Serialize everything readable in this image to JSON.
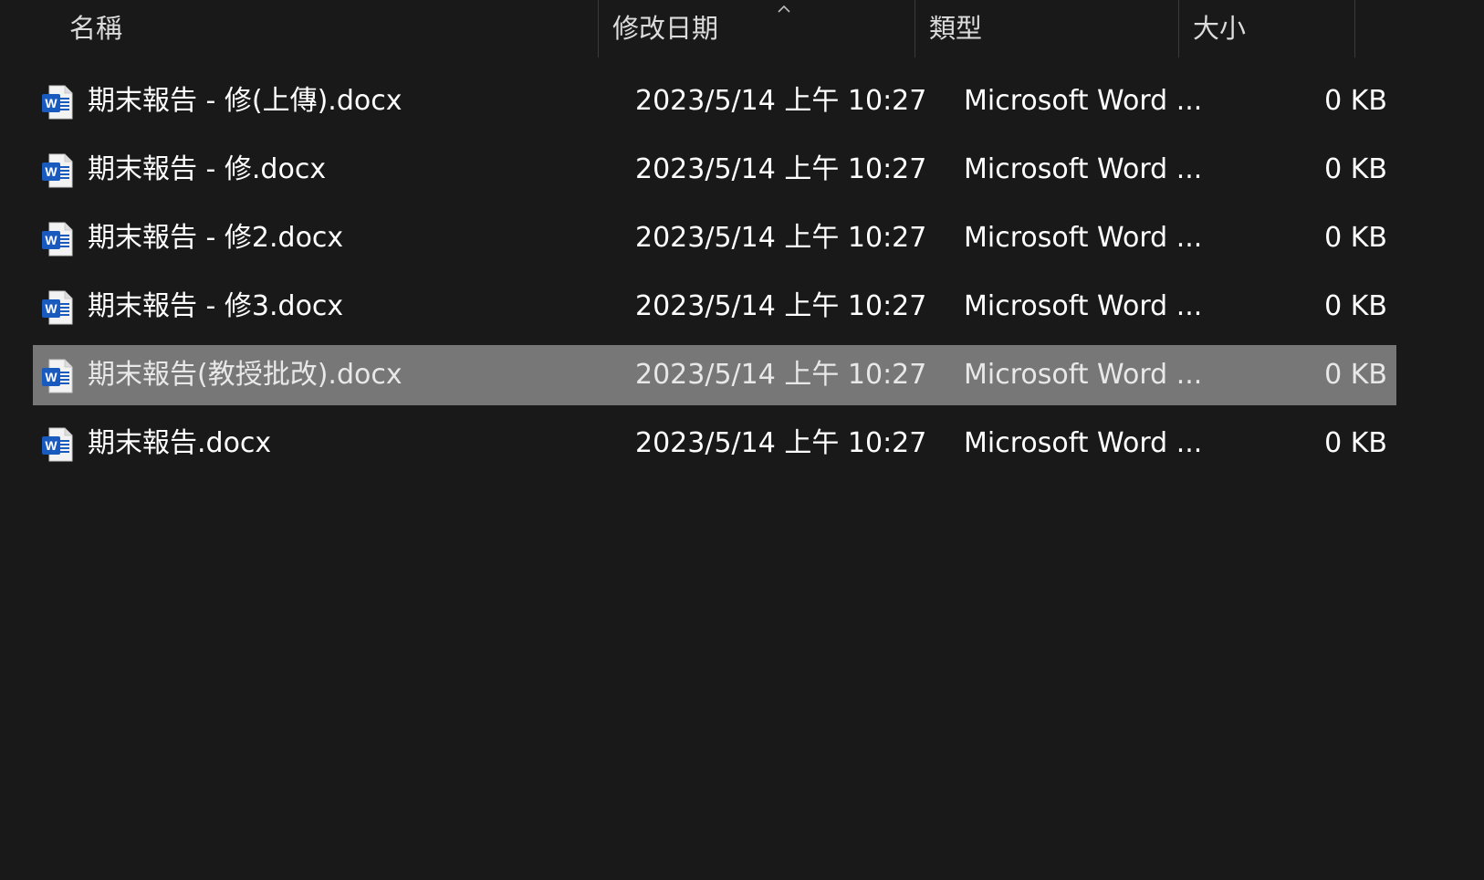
{
  "columns": {
    "name": "名稱",
    "date": "修改日期",
    "type": "類型",
    "size": "大小"
  },
  "sort": {
    "column": "date",
    "direction": "ascending",
    "icon": "chevron-up-icon"
  },
  "files": [
    {
      "icon": "word-document-icon",
      "name": "期末報告 - 修(上傳).docx",
      "date": "2023/5/14 上午 10:27",
      "type": "Microsoft Word ...",
      "size": "0 KB",
      "selected": false
    },
    {
      "icon": "word-document-icon",
      "name": "期末報告 - 修.docx",
      "date": "2023/5/14 上午 10:27",
      "type": "Microsoft Word ...",
      "size": "0 KB",
      "selected": false
    },
    {
      "icon": "word-document-icon",
      "name": "期末報告 - 修2.docx",
      "date": "2023/5/14 上午 10:27",
      "type": "Microsoft Word ...",
      "size": "0 KB",
      "selected": false
    },
    {
      "icon": "word-document-icon",
      "name": "期末報告 - 修3.docx",
      "date": "2023/5/14 上午 10:27",
      "type": "Microsoft Word ...",
      "size": "0 KB",
      "selected": false
    },
    {
      "icon": "word-document-icon",
      "name": "期末報告(教授批改).docx",
      "date": "2023/5/14 上午 10:27",
      "type": "Microsoft Word ...",
      "size": "0 KB",
      "selected": true
    },
    {
      "icon": "word-document-icon",
      "name": "期末報告.docx",
      "date": "2023/5/14 上午 10:27",
      "type": "Microsoft Word ...",
      "size": "0 KB",
      "selected": false
    }
  ],
  "colors": {
    "background": "#191919",
    "selected_row": "#777777",
    "word_blue": "#185abd",
    "text": "#ffffff"
  }
}
